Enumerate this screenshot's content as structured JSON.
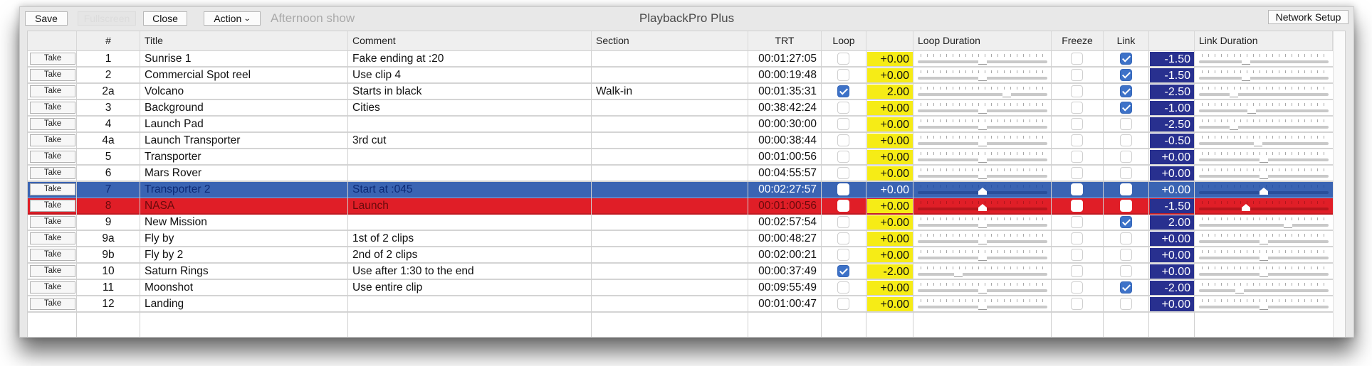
{
  "app": {
    "title": "PlaybackPro Plus",
    "show_name": "Afternoon show"
  },
  "toolbar": {
    "save_label": "Save",
    "fullscreen_label": "Fullscreen",
    "close_label": "Close",
    "action_label": "Action",
    "network_setup_label": "Network Setup"
  },
  "columns": {
    "take": "",
    "num": "#",
    "title": "Title",
    "comment": "Comment",
    "section": "Section",
    "trt": "TRT",
    "loop": "Loop",
    "loop_value": "",
    "loop_duration": "Loop Duration",
    "freeze": "Freeze",
    "link": "Link",
    "link_value": "",
    "link_duration": "Link Duration"
  },
  "slider_range": [
    -5,
    5
  ],
  "colors": {
    "selected_blue": "#3a64b3",
    "playing_red": "#e01e27",
    "loop_value_yellow": "#f6ec16",
    "link_value_navy": "#28308f",
    "checkbox_blue": "#3d72c8"
  },
  "take_label": "Take",
  "rows": [
    {
      "num": "1",
      "title": "Sunrise 1",
      "comment": "Fake ending at :20",
      "section": "",
      "trt": "00:01:27:05",
      "loop": false,
      "loop_value": "+0.00",
      "loop_dur": 0,
      "freeze": false,
      "link": true,
      "link_value": "-1.50",
      "link_dur": -1.5,
      "state": ""
    },
    {
      "num": "2",
      "title": "Commercial Spot reel",
      "comment": "Use clip 4",
      "section": "",
      "trt": "00:00:19:48",
      "loop": false,
      "loop_value": "+0.00",
      "loop_dur": 0,
      "freeze": false,
      "link": true,
      "link_value": "-1.50",
      "link_dur": -1.5,
      "state": ""
    },
    {
      "num": "2a",
      "title": "Volcano",
      "comment": "Starts in black",
      "section": "Walk-in",
      "trt": "00:01:35:31",
      "loop": true,
      "loop_value": "2.00",
      "loop_dur": 2,
      "freeze": false,
      "link": true,
      "link_value": "-2.50",
      "link_dur": -2.5,
      "state": ""
    },
    {
      "num": "3",
      "title": "Background",
      "comment": "Cities",
      "section": "",
      "trt": "00:38:42:24",
      "loop": false,
      "loop_value": "+0.00",
      "loop_dur": 0,
      "freeze": false,
      "link": true,
      "link_value": "-1.00",
      "link_dur": -1,
      "state": ""
    },
    {
      "num": "4",
      "title": "Launch Pad",
      "comment": "",
      "section": "",
      "trt": "00:00:30:00",
      "loop": false,
      "loop_value": "+0.00",
      "loop_dur": 0,
      "freeze": false,
      "link": false,
      "link_value": "-2.50",
      "link_dur": -2.5,
      "state": ""
    },
    {
      "num": "4a",
      "title": "Launch Transporter",
      "comment": "3rd cut",
      "section": "",
      "trt": "00:00:38:44",
      "loop": false,
      "loop_value": "+0.00",
      "loop_dur": 0,
      "freeze": false,
      "link": false,
      "link_value": "-0.50",
      "link_dur": -0.5,
      "state": ""
    },
    {
      "num": "5",
      "title": "Transporter",
      "comment": "",
      "section": "",
      "trt": "00:01:00:56",
      "loop": false,
      "loop_value": "+0.00",
      "loop_dur": 0,
      "freeze": false,
      "link": false,
      "link_value": "+0.00",
      "link_dur": 0,
      "state": ""
    },
    {
      "num": "6",
      "title": "Mars Rover",
      "comment": "",
      "section": "",
      "trt": "00:04:55:57",
      "loop": false,
      "loop_value": "+0.00",
      "loop_dur": 0,
      "freeze": false,
      "link": false,
      "link_value": "+0.00",
      "link_dur": 0,
      "state": ""
    },
    {
      "num": "7",
      "title": "Transporter 2",
      "comment": "Start at :045",
      "section": "",
      "trt": "00:02:27:57",
      "loop": false,
      "loop_value": "+0.00",
      "loop_dur": 0,
      "freeze": false,
      "link": false,
      "link_value": "+0.00",
      "link_dur": 0,
      "state": "selected"
    },
    {
      "num": "8",
      "title": "NASA",
      "comment": "Launch",
      "section": "",
      "trt": "00:01:00:56",
      "loop": false,
      "loop_value": "+0.00",
      "loop_dur": 0,
      "freeze": false,
      "link": false,
      "link_value": "-1.50",
      "link_dur": -1.5,
      "state": "playing"
    },
    {
      "num": "9",
      "title": "New Mission",
      "comment": "",
      "section": "",
      "trt": "00:02:57:54",
      "loop": false,
      "loop_value": "+0.00",
      "loop_dur": 0,
      "freeze": false,
      "link": true,
      "link_value": "2.00",
      "link_dur": 2,
      "state": ""
    },
    {
      "num": "9a",
      "title": "Fly by",
      "comment": "1st of 2 clips",
      "section": "",
      "trt": "00:00:48:27",
      "loop": false,
      "loop_value": "+0.00",
      "loop_dur": 0,
      "freeze": false,
      "link": false,
      "link_value": "+0.00",
      "link_dur": 0,
      "state": ""
    },
    {
      "num": "9b",
      "title": "Fly by 2",
      "comment": "2nd of 2 clips",
      "section": "",
      "trt": "00:02:00:21",
      "loop": false,
      "loop_value": "+0.00",
      "loop_dur": 0,
      "freeze": false,
      "link": false,
      "link_value": "+0.00",
      "link_dur": 0,
      "state": ""
    },
    {
      "num": "10",
      "title": "Saturn Rings",
      "comment": "Use after 1:30 to the end",
      "section": "",
      "trt": "00:00:37:49",
      "loop": true,
      "loop_value": "-2.00",
      "loop_dur": -2,
      "freeze": false,
      "link": false,
      "link_value": "+0.00",
      "link_dur": 0,
      "state": ""
    },
    {
      "num": "11",
      "title": "Moonshot",
      "comment": "Use entire clip",
      "section": "",
      "trt": "00:09:55:49",
      "loop": false,
      "loop_value": "+0.00",
      "loop_dur": 0,
      "freeze": false,
      "link": true,
      "link_value": "-2.00",
      "link_dur": -2,
      "state": ""
    },
    {
      "num": "12",
      "title": "Landing",
      "comment": "",
      "section": "",
      "trt": "00:01:00:47",
      "loop": false,
      "loop_value": "+0.00",
      "loop_dur": 0,
      "freeze": false,
      "link": false,
      "link_value": "+0.00",
      "link_dur": 0,
      "state": ""
    }
  ]
}
